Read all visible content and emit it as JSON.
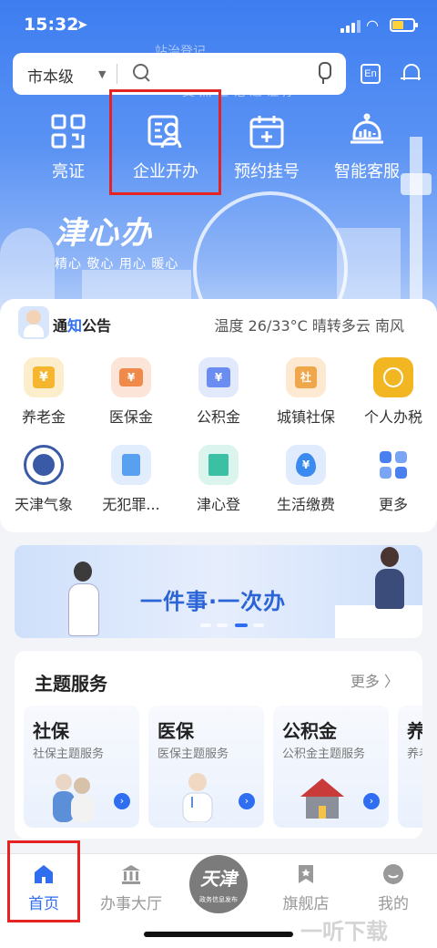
{
  "status": {
    "time": "15:32"
  },
  "search": {
    "level": "市本级",
    "hint_top": "站治登记",
    "hint_bottom": "支 照 理 记 之 证明"
  },
  "header": {
    "lang": "En"
  },
  "quick": [
    {
      "label": "亮证",
      "icon": "qr-code-icon"
    },
    {
      "label": "企业开办",
      "icon": "business-card-icon"
    },
    {
      "label": "预约挂号",
      "icon": "calendar-plus-icon"
    },
    {
      "label": "智能客服",
      "icon": "robot-icon"
    }
  ],
  "brand": {
    "name": "津心办",
    "slogan": "精心 敬心 用心 暖心"
  },
  "notice": {
    "prefix": "通",
    "highlight": "知",
    "suffix": "公告",
    "weather": "温度 26/33°C 晴转多云 南风"
  },
  "services": [
    {
      "label": "养老金",
      "icon": "pension-icon",
      "color": "#f5b52e"
    },
    {
      "label": "医保金",
      "icon": "medical-insurance-icon",
      "color": "#f08a4b"
    },
    {
      "label": "公积金",
      "icon": "housing-fund-icon",
      "color": "#6b8cf0"
    },
    {
      "label": "城镇社保",
      "icon": "social-security-icon",
      "color": "#f0a64a"
    },
    {
      "label": "个人办税",
      "icon": "tax-icon",
      "color": "#f2b622"
    },
    {
      "label": "天津气象",
      "icon": "weather-bureau-icon",
      "color": "#3a5aa8"
    },
    {
      "label": "无犯罪...",
      "icon": "document-icon",
      "color": "#5aa0f0"
    },
    {
      "label": "津心登",
      "icon": "building-icon",
      "color": "#3cc0a4"
    },
    {
      "label": "生活缴费",
      "icon": "payment-drop-icon",
      "color": "#3a8af0"
    },
    {
      "label": "更多",
      "icon": "grid-more-icon",
      "color": "#4a7ff0"
    }
  ],
  "banner": {
    "text": "一件事·一次办"
  },
  "theme": {
    "title": "主题服务",
    "more": "更多 〉",
    "cards": [
      {
        "title": "社保",
        "subtitle": "社保主题服务"
      },
      {
        "title": "医保",
        "subtitle": "医保主题服务"
      },
      {
        "title": "公积金",
        "subtitle": "公积金主题服务"
      },
      {
        "title": "养",
        "subtitle": "养老"
      }
    ]
  },
  "tabs": [
    {
      "label": "首页",
      "icon": "home-icon",
      "active": true
    },
    {
      "label": "办事大厅",
      "icon": "government-hall-icon",
      "active": false
    },
    {
      "label": "旗舰店",
      "icon": "bookmark-star-icon",
      "active": false
    },
    {
      "label": "我的",
      "icon": "profile-icon",
      "active": false
    }
  ],
  "center_tab": {
    "title": "天津",
    "subtitle": "政务信息发布"
  },
  "watermark": "一听下载"
}
